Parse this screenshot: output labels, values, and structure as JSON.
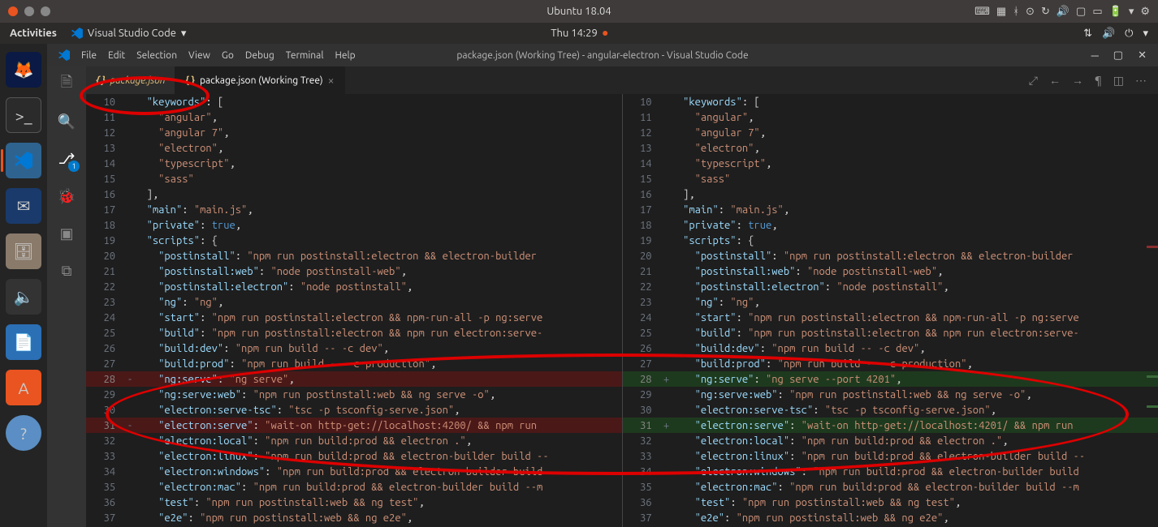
{
  "window": {
    "title": "Ubuntu 18.04"
  },
  "gnome": {
    "activities": "Activities",
    "app_name": "Visual Studio Code",
    "clock": "Thu 14:29"
  },
  "vscode": {
    "title": "package.json (Working Tree) - angular-electron - Visual Studio Code",
    "menu": [
      "File",
      "Edit",
      "Selection",
      "View",
      "Go",
      "Debug",
      "Terminal",
      "Help"
    ],
    "tabs": [
      {
        "label": "package.json",
        "active": false,
        "modified": true
      },
      {
        "label": "package.json (Working Tree)",
        "active": true,
        "modified": false
      }
    ],
    "scm_badge": "1"
  },
  "left_lines": [
    {
      "n": 10,
      "m": "",
      "html": "  <span class='s-key'>\"keywords\"</span><span class='s-punc'>: [</span>"
    },
    {
      "n": 11,
      "m": "",
      "html": "    <span class='s-str'>\"angular\"</span><span class='s-punc'>,</span>"
    },
    {
      "n": 12,
      "m": "",
      "html": "    <span class='s-str'>\"angular 7\"</span><span class='s-punc'>,</span>"
    },
    {
      "n": 13,
      "m": "",
      "html": "    <span class='s-str'>\"electron\"</span><span class='s-punc'>,</span>"
    },
    {
      "n": 14,
      "m": "",
      "html": "    <span class='s-str'>\"typescript\"</span><span class='s-punc'>,</span>"
    },
    {
      "n": 15,
      "m": "",
      "html": "    <span class='s-str'>\"sass\"</span>"
    },
    {
      "n": 16,
      "m": "",
      "html": "  <span class='s-punc'>],</span>"
    },
    {
      "n": 17,
      "m": "",
      "html": "  <span class='s-key'>\"main\"</span><span class='s-punc'>: </span><span class='s-str'>\"main.js\"</span><span class='s-punc'>,</span>"
    },
    {
      "n": 18,
      "m": "",
      "html": "  <span class='s-key'>\"private\"</span><span class='s-punc'>: </span><span class='s-bool'>true</span><span class='s-punc'>,</span>"
    },
    {
      "n": 19,
      "m": "",
      "html": "  <span class='s-key'>\"scripts\"</span><span class='s-punc'>: {</span>"
    },
    {
      "n": 20,
      "m": "",
      "html": "    <span class='s-key'>\"postinstall\"</span><span class='s-punc'>: </span><span class='s-str'>\"npm run postinstall:electron && electron-builder</span>"
    },
    {
      "n": 21,
      "m": "",
      "html": "    <span class='s-key'>\"postinstall:web\"</span><span class='s-punc'>: </span><span class='s-str'>\"node postinstall-web\"</span><span class='s-punc'>,</span>"
    },
    {
      "n": 22,
      "m": "",
      "html": "    <span class='s-key'>\"postinstall:electron\"</span><span class='s-punc'>: </span><span class='s-str'>\"node postinstall\"</span><span class='s-punc'>,</span>"
    },
    {
      "n": 23,
      "m": "",
      "html": "    <span class='s-key'>\"ng\"</span><span class='s-punc'>: </span><span class='s-str'>\"ng\"</span><span class='s-punc'>,</span>"
    },
    {
      "n": 24,
      "m": "",
      "html": "    <span class='s-key'>\"start\"</span><span class='s-punc'>: </span><span class='s-str'>\"npm run postinstall:electron && npm-run-all -p ng:serve</span>"
    },
    {
      "n": 25,
      "m": "",
      "html": "    <span class='s-key'>\"build\"</span><span class='s-punc'>: </span><span class='s-str'>\"npm run postinstall:electron && npm run electron:serve-</span>"
    },
    {
      "n": 26,
      "m": "",
      "html": "    <span class='s-key'>\"build:dev\"</span><span class='s-punc'>: </span><span class='s-str'>\"npm run build -- -c dev\"</span><span class='s-punc'>,</span>"
    },
    {
      "n": 27,
      "m": "",
      "html": "    <span class='s-key'>\"build:prod\"</span><span class='s-punc'>: </span><span class='s-str'>\"npm run build -- -c production\"</span><span class='s-punc'>,</span>"
    },
    {
      "n": 28,
      "m": "-",
      "cls": "removed",
      "html": "    <span class='s-key'>\"ng:serve\"</span><span class='s-punc'>: </span><span class='s-str'>\"ng serve\"</span><span class='s-punc'>,</span>"
    },
    {
      "n": 29,
      "m": "",
      "html": "    <span class='s-key'>\"ng:serve:web\"</span><span class='s-punc'>: </span><span class='s-str'>\"npm run postinstall:web && ng serve -o\"</span><span class='s-punc'>,</span>"
    },
    {
      "n": 30,
      "m": "",
      "html": "    <span class='s-key'>\"electron:serve-tsc\"</span><span class='s-punc'>: </span><span class='s-str'>\"tsc -p tsconfig-serve.json\"</span><span class='s-punc'>,</span>"
    },
    {
      "n": 31,
      "m": "-",
      "cls": "removed",
      "html": "    <span class='s-key'>\"electron:serve\"</span><span class='s-punc'>: </span><span class='s-str'>\"wait-on http-get://localhost:4200/ && npm run</span>"
    },
    {
      "n": 32,
      "m": "",
      "html": "    <span class='s-key'>\"electron:local\"</span><span class='s-punc'>: </span><span class='s-str'>\"npm run build:prod && electron .\"</span><span class='s-punc'>,</span>"
    },
    {
      "n": 33,
      "m": "",
      "html": "    <span class='s-key'>\"electron:linux\"</span><span class='s-punc'>: </span><span class='s-str'>\"npm run build:prod && electron-builder build --</span>"
    },
    {
      "n": 34,
      "m": "",
      "html": "    <span class='s-key'>\"electron:windows\"</span><span class='s-punc'>: </span><span class='s-str'>\"npm run build:prod && electron-builder build</span>"
    },
    {
      "n": 35,
      "m": "",
      "html": "    <span class='s-key'>\"electron:mac\"</span><span class='s-punc'>: </span><span class='s-str'>\"npm run build:prod && electron-builder build --m</span>"
    },
    {
      "n": 36,
      "m": "",
      "html": "    <span class='s-key'>\"test\"</span><span class='s-punc'>: </span><span class='s-str'>\"npm run postinstall:web && ng test\"</span><span class='s-punc'>,</span>"
    },
    {
      "n": 37,
      "m": "",
      "html": "    <span class='s-key'>\"e2e\"</span><span class='s-punc'>: </span><span class='s-str'>\"npm run postinstall:web && ng e2e\"</span><span class='s-punc'>,</span>"
    }
  ],
  "right_lines": [
    {
      "n": 10,
      "m": "",
      "html": "  <span class='s-key'>\"keywords\"</span><span class='s-punc'>: [</span>"
    },
    {
      "n": 11,
      "m": "",
      "html": "    <span class='s-str'>\"angular\"</span><span class='s-punc'>,</span>"
    },
    {
      "n": 12,
      "m": "",
      "html": "    <span class='s-str'>\"angular 7\"</span><span class='s-punc'>,</span>"
    },
    {
      "n": 13,
      "m": "",
      "html": "    <span class='s-str'>\"electron\"</span><span class='s-punc'>,</span>"
    },
    {
      "n": 14,
      "m": "",
      "html": "    <span class='s-str'>\"typescript\"</span><span class='s-punc'>,</span>"
    },
    {
      "n": 15,
      "m": "",
      "html": "    <span class='s-str'>\"sass\"</span>"
    },
    {
      "n": 16,
      "m": "",
      "html": "  <span class='s-punc'>],</span>"
    },
    {
      "n": 17,
      "m": "",
      "html": "  <span class='s-key'>\"main\"</span><span class='s-punc'>: </span><span class='s-str'>\"main.js\"</span><span class='s-punc'>,</span>"
    },
    {
      "n": 18,
      "m": "",
      "html": "  <span class='s-key'>\"private\"</span><span class='s-punc'>: </span><span class='s-bool'>true</span><span class='s-punc'>,</span>"
    },
    {
      "n": 19,
      "m": "",
      "html": "  <span class='s-key'>\"scripts\"</span><span class='s-punc'>: {</span>"
    },
    {
      "n": 20,
      "m": "",
      "html": "    <span class='s-key'>\"postinstall\"</span><span class='s-punc'>: </span><span class='s-str'>\"npm run postinstall:electron && electron-builder</span>"
    },
    {
      "n": 21,
      "m": "",
      "html": "    <span class='s-key'>\"postinstall:web\"</span><span class='s-punc'>: </span><span class='s-str'>\"node postinstall-web\"</span><span class='s-punc'>,</span>"
    },
    {
      "n": 22,
      "m": "",
      "html": "    <span class='s-key'>\"postinstall:electron\"</span><span class='s-punc'>: </span><span class='s-str'>\"node postinstall\"</span><span class='s-punc'>,</span>"
    },
    {
      "n": 23,
      "m": "",
      "html": "    <span class='s-key'>\"ng\"</span><span class='s-punc'>: </span><span class='s-str'>\"ng\"</span><span class='s-punc'>,</span>"
    },
    {
      "n": 24,
      "m": "",
      "html": "    <span class='s-key'>\"start\"</span><span class='s-punc'>: </span><span class='s-str'>\"npm run postinstall:electron && npm-run-all -p ng:serve</span>"
    },
    {
      "n": 25,
      "m": "",
      "html": "    <span class='s-key'>\"build\"</span><span class='s-punc'>: </span><span class='s-str'>\"npm run postinstall:electron && npm run electron:serve-</span>"
    },
    {
      "n": 26,
      "m": "",
      "html": "    <span class='s-key'>\"build:dev\"</span><span class='s-punc'>: </span><span class='s-str'>\"npm run build -- -c dev\"</span><span class='s-punc'>,</span>"
    },
    {
      "n": 27,
      "m": "",
      "html": "    <span class='s-key'>\"build:prod\"</span><span class='s-punc'>: </span><span class='s-str'>\"npm run build -- -c production\"</span><span class='s-punc'>,</span>"
    },
    {
      "n": 28,
      "m": "+",
      "cls": "added",
      "html": "    <span class='s-key'>\"ng:serve\"</span><span class='s-punc'>: </span><span class='s-str'>\"ng serve --port 4201\"</span><span class='s-punc'>,</span>"
    },
    {
      "n": 29,
      "m": "",
      "html": "    <span class='s-key'>\"ng:serve:web\"</span><span class='s-punc'>: </span><span class='s-str'>\"npm run postinstall:web && ng serve -o\"</span><span class='s-punc'>,</span>"
    },
    {
      "n": 30,
      "m": "",
      "html": "    <span class='s-key'>\"electron:serve-tsc\"</span><span class='s-punc'>: </span><span class='s-str'>\"tsc -p tsconfig-serve.json\"</span><span class='s-punc'>,</span>"
    },
    {
      "n": 31,
      "m": "+",
      "cls": "added",
      "html": "    <span class='s-key'>\"electron:serve\"</span><span class='s-punc'>: </span><span class='s-str'>\"wait-on http-get://localhost:4201/ && npm run</span>"
    },
    {
      "n": 32,
      "m": "",
      "html": "    <span class='s-key'>\"electron:local\"</span><span class='s-punc'>: </span><span class='s-str'>\"npm run build:prod && electron .\"</span><span class='s-punc'>,</span>"
    },
    {
      "n": 33,
      "m": "",
      "html": "    <span class='s-key'>\"electron:linux\"</span><span class='s-punc'>: </span><span class='s-str'>\"npm run build:prod && electron-builder build --</span>"
    },
    {
      "n": 34,
      "m": "",
      "html": "    <span class='s-key'>\"electron:windows\"</span><span class='s-punc'>: </span><span class='s-str'>\"npm run build:prod && electron-builder build</span>"
    },
    {
      "n": 35,
      "m": "",
      "html": "    <span class='s-key'>\"electron:mac\"</span><span class='s-punc'>: </span><span class='s-str'>\"npm run build:prod && electron-builder build --m</span>"
    },
    {
      "n": 36,
      "m": "",
      "html": "    <span class='s-key'>\"test\"</span><span class='s-punc'>: </span><span class='s-str'>\"npm run postinstall:web && ng test\"</span><span class='s-punc'>,</span>"
    },
    {
      "n": 37,
      "m": "",
      "html": "    <span class='s-key'>\"e2e\"</span><span class='s-punc'>: </span><span class='s-str'>\"npm run postinstall:web && ng e2e\"</span><span class='s-punc'>,</span>"
    }
  ]
}
